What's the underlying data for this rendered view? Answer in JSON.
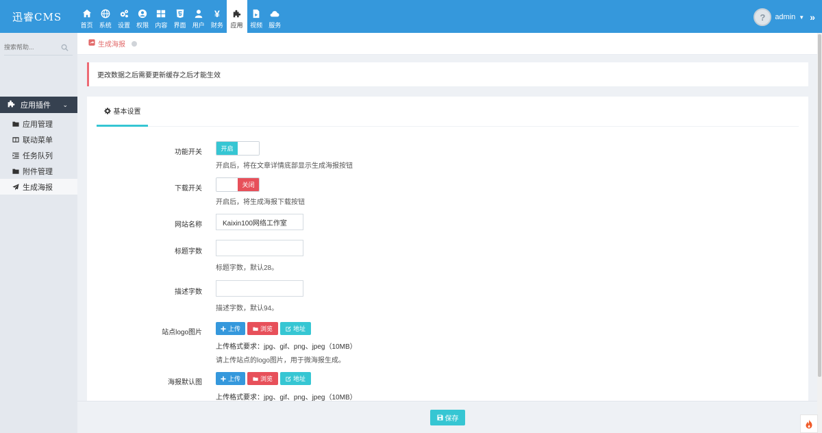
{
  "app": {
    "logo": "迅睿CMS"
  },
  "nav": [
    {
      "label": "首页",
      "icon": "home-icon"
    },
    {
      "label": "系统",
      "icon": "globe-icon"
    },
    {
      "label": "设置",
      "icon": "cogs-icon"
    },
    {
      "label": "权限",
      "icon": "user-circle-icon"
    },
    {
      "label": "内容",
      "icon": "th-large-icon"
    },
    {
      "label": "界面",
      "icon": "html5-icon"
    },
    {
      "label": "用户",
      "icon": "user-icon"
    },
    {
      "label": "财务",
      "icon": "yen-icon"
    },
    {
      "label": "应用",
      "icon": "puzzle-icon",
      "active": true
    },
    {
      "label": "视频",
      "icon": "file-video-icon"
    },
    {
      "label": "服务",
      "icon": "cloud-icon"
    }
  ],
  "user": {
    "name": "admin",
    "avatar_text": "?"
  },
  "sidebar": {
    "search_placeholder": "搜索帮助...",
    "group": "应用插件",
    "items": [
      {
        "label": "应用管理",
        "icon": "folder-icon"
      },
      {
        "label": "联动菜单",
        "icon": "columns-icon"
      },
      {
        "label": "任务队列",
        "icon": "indent-icon"
      },
      {
        "label": "附件管理",
        "icon": "folder-icon"
      },
      {
        "label": "生成海报",
        "icon": "send-icon",
        "active": true
      }
    ]
  },
  "breadcrumb": {
    "text": "生成海报"
  },
  "alert": {
    "text": "更改数据之后需要更新缓存之后才能生效"
  },
  "tab": {
    "label": "基本设置"
  },
  "form": {
    "feature_switch": {
      "label": "功能开关",
      "on_text": "开启",
      "help": "开启后，将在文章详情底部显示生成海报按钮"
    },
    "download_switch": {
      "label": "下载开关",
      "off_text": "关闭",
      "help": "开启后，将生成海报下载按钮"
    },
    "site_name": {
      "label": "网站名称",
      "value": "Kaixin100网络工作室"
    },
    "title_len": {
      "label": "标题字数",
      "value": "",
      "help": "标题字数，默认28。"
    },
    "desc_len": {
      "label": "描述字数",
      "value": "",
      "help": "描述字数，默认94。"
    },
    "site_logo": {
      "label": "站点logo图片",
      "upload": "上传",
      "browse": "浏览",
      "address": "地址",
      "format": "上传格式要求：jpg、gif、png、jpeg（10MB）",
      "help": "请上传站点的logo图片，用于微海报生成。"
    },
    "poster_default": {
      "label": "海报默认图",
      "upload": "上传",
      "browse": "浏览",
      "address": "地址",
      "format": "上传格式要求：jpg、gif、png、jpeg（10MB）"
    }
  },
  "footer": {
    "save": "保存"
  },
  "colors": {
    "primary": "#3598dc",
    "cyan": "#36c6d3",
    "red": "#e7505a",
    "dark": "#364150"
  }
}
